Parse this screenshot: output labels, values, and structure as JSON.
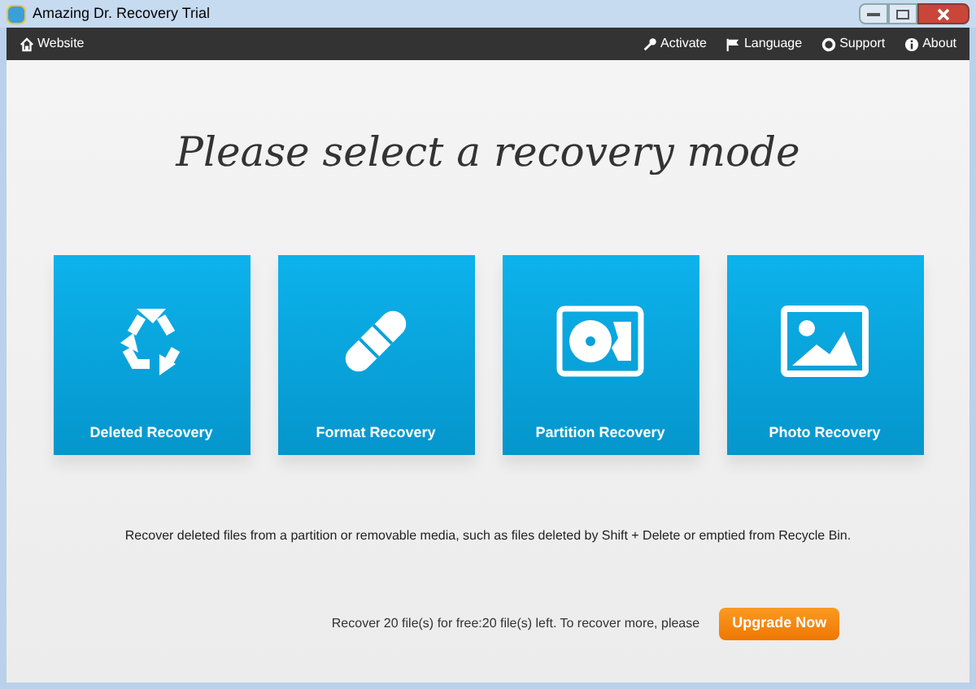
{
  "window": {
    "title": "Amazing Dr. Recovery Trial"
  },
  "toolbar": {
    "left": [
      {
        "kind": "home",
        "label": "Website"
      }
    ],
    "right": [
      {
        "kind": "key",
        "label": "Activate"
      },
      {
        "kind": "flag",
        "label": "Language"
      },
      {
        "kind": "lifebuoy",
        "label": "Support"
      },
      {
        "kind": "info",
        "label": "About"
      }
    ]
  },
  "heading": "Please select a recovery mode",
  "modes": [
    {
      "kind": "recycle",
      "label": "Deleted Recovery"
    },
    {
      "kind": "bandage",
      "label": "Format Recovery"
    },
    {
      "kind": "disk",
      "label": "Partition Recovery"
    },
    {
      "kind": "photo",
      "label": "Photo Recovery"
    }
  ],
  "description": "Recover deleted files from a partition or removable media, such as files deleted by Shift + Delete or emptied from Recycle Bin.",
  "footer": {
    "text": "Recover 20 file(s) for free:20 file(s) left. To recover more, please",
    "button": "Upgrade Now"
  }
}
